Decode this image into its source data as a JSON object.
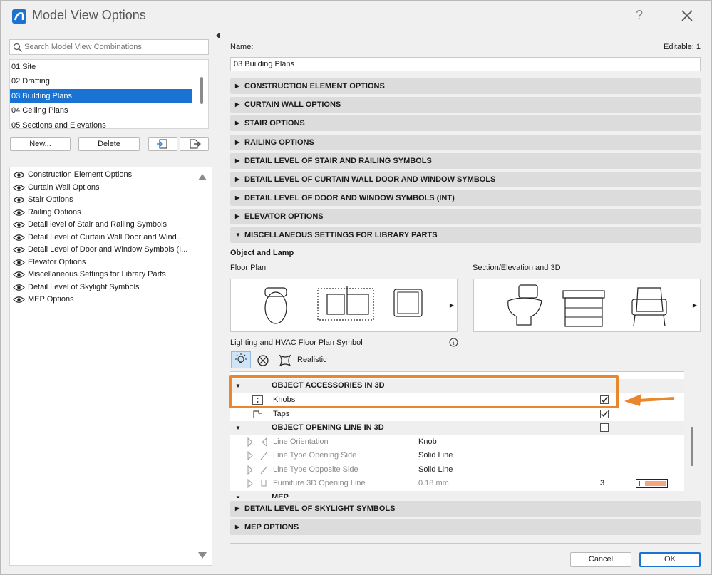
{
  "window": {
    "title": "Model View Options",
    "help": "?"
  },
  "search": {
    "placeholder": "Search Model View Combinations"
  },
  "combinations": [
    {
      "label": "01 Site",
      "selected": false
    },
    {
      "label": "02 Drafting",
      "selected": false
    },
    {
      "label": "03 Building Plans",
      "selected": true
    },
    {
      "label": "04 Ceiling Plans",
      "selected": false
    },
    {
      "label": "05 Sections and Elevations",
      "selected": false
    }
  ],
  "buttons": {
    "new": "New...",
    "delete": "Delete",
    "cancel": "Cancel",
    "ok": "OK"
  },
  "option_list": [
    "Construction Element Options",
    "Curtain Wall Options",
    "Stair Options",
    "Railing Options",
    "Detail level of Stair and Railing Symbols",
    "Detail Level of Curtain Wall Door and Wind...",
    "Detail Level of Door and Window Symbols (I...",
    "Elevator Options",
    "Miscellaneous Settings for Library Parts",
    "Detail Level of Skylight Symbols",
    "MEP Options"
  ],
  "name": {
    "label": "Name:",
    "editable": "Editable: 1",
    "value": "03 Building Plans"
  },
  "sections": [
    "CONSTRUCTION ELEMENT OPTIONS",
    "CURTAIN WALL OPTIONS",
    "STAIR OPTIONS",
    "RAILING OPTIONS",
    "DETAIL LEVEL OF STAIR AND RAILING SYMBOLS",
    "DETAIL LEVEL OF CURTAIN WALL DOOR AND WINDOW SYMBOLS",
    "DETAIL LEVEL OF DOOR AND WINDOW SYMBOLS (INT)",
    "ELEVATOR OPTIONS",
    "MISCELLANEOUS SETTINGS FOR LIBRARY PARTS"
  ],
  "bottom_sections": [
    "DETAIL LEVEL OF SKYLIGHT SYMBOLS",
    "MEP OPTIONS"
  ],
  "misc": {
    "subtitle": "Object and Lamp",
    "floor_plan": "Floor Plan",
    "section_3d": "Section/Elevation and 3D",
    "lighting": "Lighting and HVAC Floor Plan Symbol",
    "realistic": "Realistic"
  },
  "table": {
    "group1": "OBJECT ACCESSORIES IN 3D",
    "knobs": "Knobs",
    "taps": "Taps",
    "group2": "OBJECT OPENING LINE IN 3D",
    "rows": [
      {
        "label": "Line Orientation",
        "value": "Knob"
      },
      {
        "label": "Line Type Opening Side",
        "value": "Solid Line"
      },
      {
        "label": "Line Type Opposite Side",
        "value": "Solid Line"
      },
      {
        "label": "Furniture 3D Opening Line",
        "value": "0.18 mm",
        "pen": "3"
      }
    ],
    "group3": "MEP"
  },
  "colors": {
    "accent": "#1a73d2",
    "highlight": "#e8872c",
    "pen_swatch": "#f4a684"
  }
}
